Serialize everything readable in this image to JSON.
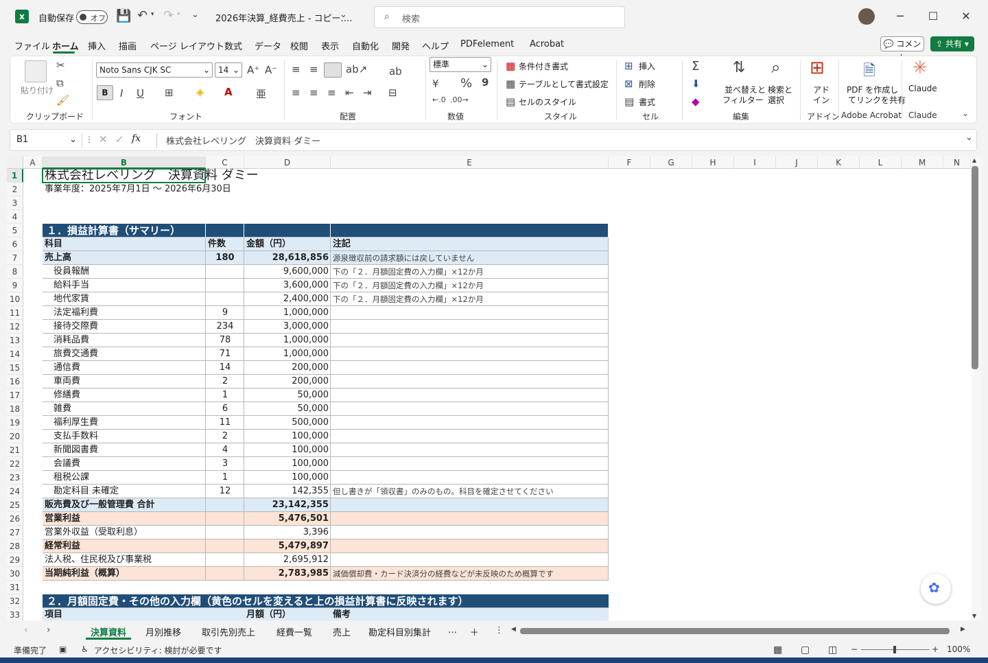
{
  "titlebar": {
    "autosave_label": "自動保存",
    "autosave_state": "オフ",
    "file_title": "2026年決算_経費売上 - コピー.…",
    "search_placeholder": "検索",
    "minimize": "─",
    "maximize": "☐",
    "close": "✕"
  },
  "menu": {
    "items": [
      "ファイル",
      "ホーム",
      "挿入",
      "描画",
      "ページ レイアウト",
      "数式",
      "データ",
      "校閲",
      "表示",
      "自動化",
      "開発",
      "ヘルプ",
      "PDFelement",
      "Acrobat"
    ],
    "active": "ホーム",
    "comment": "コメント",
    "share": "共有"
  },
  "ribbon": {
    "clipboard": {
      "paste": "貼り付け",
      "label": "クリップボード"
    },
    "font": {
      "name": "Noto Sans CJK SC",
      "size": "14",
      "label": "フォント",
      "bold": "B",
      "italic": "I",
      "underline": "U"
    },
    "alignment": {
      "label": "配置"
    },
    "number": {
      "format": "標準",
      "percent": "%",
      "comma": "9",
      "label": "数値"
    },
    "styles": {
      "conditional": "条件付き書式",
      "table": "テーブルとして書式設定",
      "cell_style": "セルのスタイル",
      "label": "スタイル"
    },
    "cells": {
      "insert": "挿入",
      "delete": "削除",
      "format": "書式",
      "label": "セル"
    },
    "editing": {
      "sort": "並べ替えと\nフィルター",
      "sort1": "並べ替えと",
      "sort2": "フィルター",
      "find1": "検索と",
      "find2": "選択",
      "label": "編集"
    },
    "addin": {
      "l1": "アド",
      "l2": "イン",
      "label": "アドイン"
    },
    "acrobat": {
      "l1": "PDF を作成し",
      "l2": "てリンクを共有",
      "label": "Adobe Acrobat"
    },
    "claude": {
      "name": "Claude",
      "label": "Claude"
    }
  },
  "formula_bar": {
    "namebox": "B1",
    "fx": "fx",
    "content": "株式会社レベリング　決算資料 ダミー"
  },
  "columns": [
    "A",
    "B",
    "C",
    "D",
    "E",
    "F",
    "G",
    "H",
    "I",
    "J",
    "K",
    "L",
    "M",
    "N"
  ],
  "rows": [
    "1",
    "2",
    "3",
    "4",
    "5",
    "6",
    "7",
    "8",
    "9",
    "10",
    "11",
    "12",
    "13",
    "14",
    "15",
    "16",
    "17",
    "18",
    "19",
    "20",
    "21",
    "22",
    "23",
    "24",
    "25",
    "26",
    "27",
    "28",
    "29",
    "30",
    "31",
    "32",
    "33"
  ],
  "sheet": {
    "title": "株式会社レベリング　決算資料 ダミー",
    "period": "事業年度：2025年7月1日 ～ 2026年6月30日",
    "section1": "１．損益計算書（サマリー）",
    "headers": [
      "科目",
      "件数",
      "金額（円）",
      "注記"
    ],
    "lines": [
      {
        "item": "売上高",
        "count": "180",
        "amount": "28,618,856",
        "note": "源泉徴収前の請求額には戻していません",
        "style": "light"
      },
      {
        "item": "　役員報酬",
        "count": "",
        "amount": "9,600,000",
        "note": "下の「２．月額固定費の入力欄」×12か月",
        "style": ""
      },
      {
        "item": "　給料手当",
        "count": "",
        "amount": "3,600,000",
        "note": "下の「２．月額固定費の入力欄」×12か月",
        "style": ""
      },
      {
        "item": "　地代家賃",
        "count": "",
        "amount": "2,400,000",
        "note": "下の「２．月額固定費の入力欄」×12か月",
        "style": ""
      },
      {
        "item": "　法定福利費",
        "count": "9",
        "amount": "1,000,000",
        "note": "",
        "style": ""
      },
      {
        "item": "　接待交際費",
        "count": "234",
        "amount": "3,000,000",
        "note": "",
        "style": ""
      },
      {
        "item": "　消耗品費",
        "count": "78",
        "amount": "1,000,000",
        "note": "",
        "style": ""
      },
      {
        "item": "　旅費交通費",
        "count": "71",
        "amount": "1,000,000",
        "note": "",
        "style": ""
      },
      {
        "item": "　通信費",
        "count": "14",
        "amount": "200,000",
        "note": "",
        "style": ""
      },
      {
        "item": "　車両費",
        "count": "2",
        "amount": "200,000",
        "note": "",
        "style": ""
      },
      {
        "item": "　修繕費",
        "count": "1",
        "amount": "50,000",
        "note": "",
        "style": ""
      },
      {
        "item": "　雑費",
        "count": "6",
        "amount": "50,000",
        "note": "",
        "style": ""
      },
      {
        "item": "　福利厚生費",
        "count": "11",
        "amount": "500,000",
        "note": "",
        "style": ""
      },
      {
        "item": "　支払手数料",
        "count": "2",
        "amount": "100,000",
        "note": "",
        "style": ""
      },
      {
        "item": "　新聞図書費",
        "count": "4",
        "amount": "100,000",
        "note": "",
        "style": ""
      },
      {
        "item": "　会議費",
        "count": "3",
        "amount": "100,000",
        "note": "",
        "style": ""
      },
      {
        "item": "　租税公課",
        "count": "1",
        "amount": "100,000",
        "note": "",
        "style": ""
      },
      {
        "item": "　勘定科目 未確定",
        "count": "12",
        "amount": "142,355",
        "note": "但し書きが「領収書」のみのもの。科目を確定させてください",
        "style": ""
      },
      {
        "item": "販売費及び一般管理費 合計",
        "count": "",
        "amount": "23,142,355",
        "note": "",
        "style": "light"
      },
      {
        "item": "営業利益",
        "count": "",
        "amount": "5,476,501",
        "note": "",
        "style": "peach"
      },
      {
        "item": "営業外収益（受取利息）",
        "count": "",
        "amount": "3,396",
        "note": "",
        "style": ""
      },
      {
        "item": "経常利益",
        "count": "",
        "amount": "5,479,897",
        "note": "",
        "style": "peach"
      },
      {
        "item": "法人税、住民税及び事業税",
        "count": "",
        "amount": "2,695,912",
        "note": "",
        "style": ""
      },
      {
        "item": "当期純利益（概算）",
        "count": "",
        "amount": "2,783,985",
        "note": "減価償却費・カード決済分の経費などが未反映のため概算です",
        "style": "peach"
      }
    ],
    "section2": "２．月額固定費・その他の入力欄（黄色のセルを変えると上の損益計算書に反映されます）",
    "section2_headers": [
      "項目",
      "",
      "月額（円）",
      "備考"
    ]
  },
  "sheet_tabs": [
    "決算資料",
    "月別推移",
    "取引先別売上",
    "経費一覧",
    "売上",
    "勘定科目別集計"
  ],
  "sheet_tab_more": "…",
  "sheet_tab_add": "＋",
  "status": {
    "ready": "準備完了",
    "accessibility": "アクセシビリティ: 検討が必要です",
    "zoom": "100%"
  },
  "colors": {
    "excel_green": "#107c41",
    "header_blue": "#1f4e79",
    "light_blue": "#ddebf7",
    "peach": "#fce4d6"
  }
}
